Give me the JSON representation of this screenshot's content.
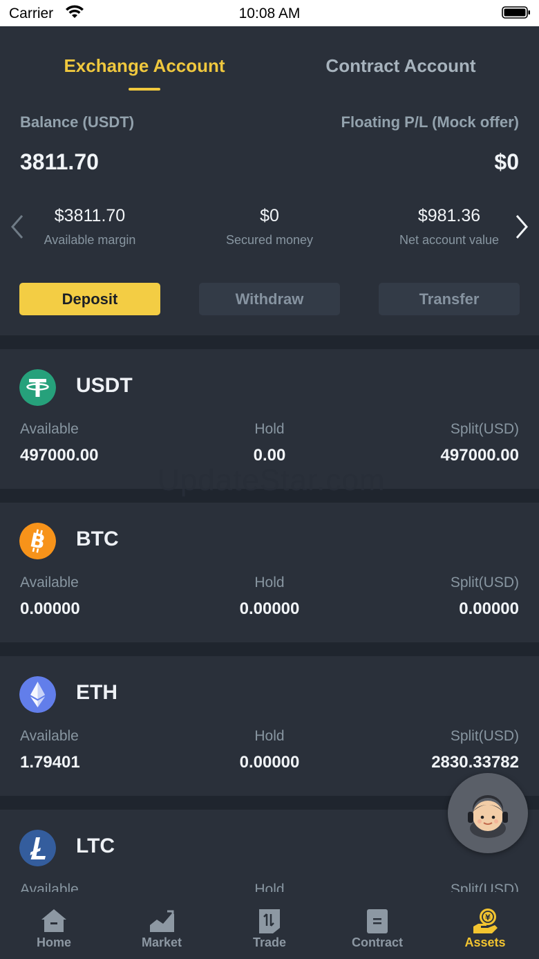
{
  "status_bar": {
    "carrier": "Carrier",
    "time": "10:08 AM"
  },
  "tabs": [
    {
      "label": "Exchange Account",
      "active": true
    },
    {
      "label": "Contract Account",
      "active": false
    }
  ],
  "balance": {
    "label": "Balance (USDT)",
    "value": "3811.70",
    "floating_label": "Floating P/L (Mock offer)",
    "floating_value": "$0"
  },
  "stats": [
    {
      "value": "$3811.70",
      "label": "Available margin"
    },
    {
      "value": "$0",
      "label": "Secured money"
    },
    {
      "value": "$981.36",
      "label": "Net account value"
    }
  ],
  "actions": {
    "deposit": "Deposit",
    "withdraw": "Withdraw",
    "transfer": "Transfer"
  },
  "watermark": "UpdateStar.com",
  "coins": [
    {
      "symbol": "USDT",
      "icon": "tether-icon",
      "color": "#26a17b",
      "available_label": "Available",
      "hold_label": "Hold",
      "split_label": "Split(USD)",
      "available": "497000.00",
      "hold": "0.00",
      "split": "497000.00"
    },
    {
      "symbol": "BTC",
      "icon": "bitcoin-icon",
      "color": "#f7931a",
      "available_label": "Available",
      "hold_label": "Hold",
      "split_label": "Split(USD)",
      "available": "0.00000",
      "hold": "0.00000",
      "split": "0.00000"
    },
    {
      "symbol": "ETH",
      "icon": "ethereum-icon",
      "color": "#627eea",
      "available_label": "Available",
      "hold_label": "Hold",
      "split_label": "Split(USD)",
      "available": "1.79401",
      "hold": "0.00000",
      "split": "2830.33782"
    },
    {
      "symbol": "LTC",
      "icon": "litecoin-icon",
      "color": "#345d9d",
      "available_label": "Available",
      "hold_label": "Hold",
      "split_label": "Split(USD)",
      "available": "",
      "hold": "",
      "split": ""
    }
  ],
  "tabbar": [
    {
      "label": "Home",
      "icon": "home-icon"
    },
    {
      "label": "Market",
      "icon": "market-icon"
    },
    {
      "label": "Trade",
      "icon": "trade-icon"
    },
    {
      "label": "Contract",
      "icon": "contract-icon"
    },
    {
      "label": "Assets",
      "icon": "assets-icon",
      "active": true
    }
  ],
  "colors": {
    "accent": "#f0c83e",
    "background": "#2a303a",
    "divider": "#1f252e"
  }
}
